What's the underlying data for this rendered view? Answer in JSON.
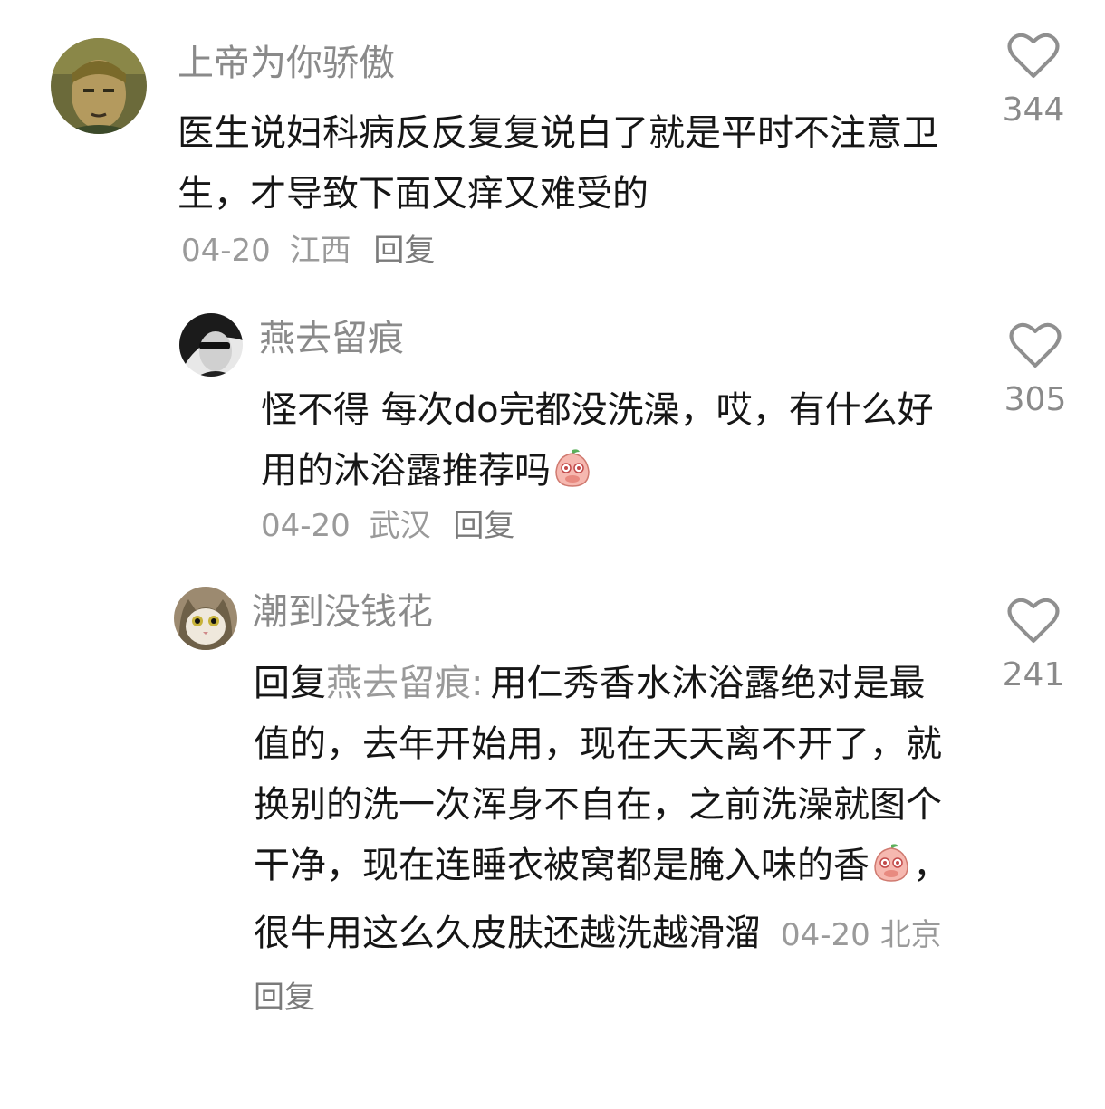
{
  "comments": [
    {
      "username": "上帝为你骄傲",
      "text": "医生说妇科病反反复复说白了就是平时不注意卫生，才导致下面又痒又难受的",
      "date": "04-20",
      "location": "江西",
      "reply_label": "回复",
      "likes": "344",
      "avatar": "avatar-anime-face"
    },
    {
      "username": "燕去留痕",
      "text": "怪不得 每次do完都没洗澡，哎，有什么好用的沐浴露推荐吗",
      "emoji": "peach-shy-emoji",
      "date": "04-20",
      "location": "武汉",
      "reply_label": "回复",
      "likes": "305",
      "avatar": "avatar-bw-portrait"
    },
    {
      "username": "潮到没钱花",
      "reply_prefix": "回复",
      "reply_to": "燕去留痕:",
      "text_part1": "用仁秀香水沐浴露绝对是最值的，去年开始用，现在天天离不开了，就换别的洗一次浑身不自在，之前洗澡就图个干净，现在连睡衣被窝都是腌入味的香",
      "emoji": "peach-shy-emoji",
      "text_part2": "，很牛用这么久皮肤还越洗越滑溜",
      "date": "04-20",
      "location": "北京",
      "reply_label": "回复",
      "likes": "241",
      "avatar": "avatar-cat"
    }
  ]
}
